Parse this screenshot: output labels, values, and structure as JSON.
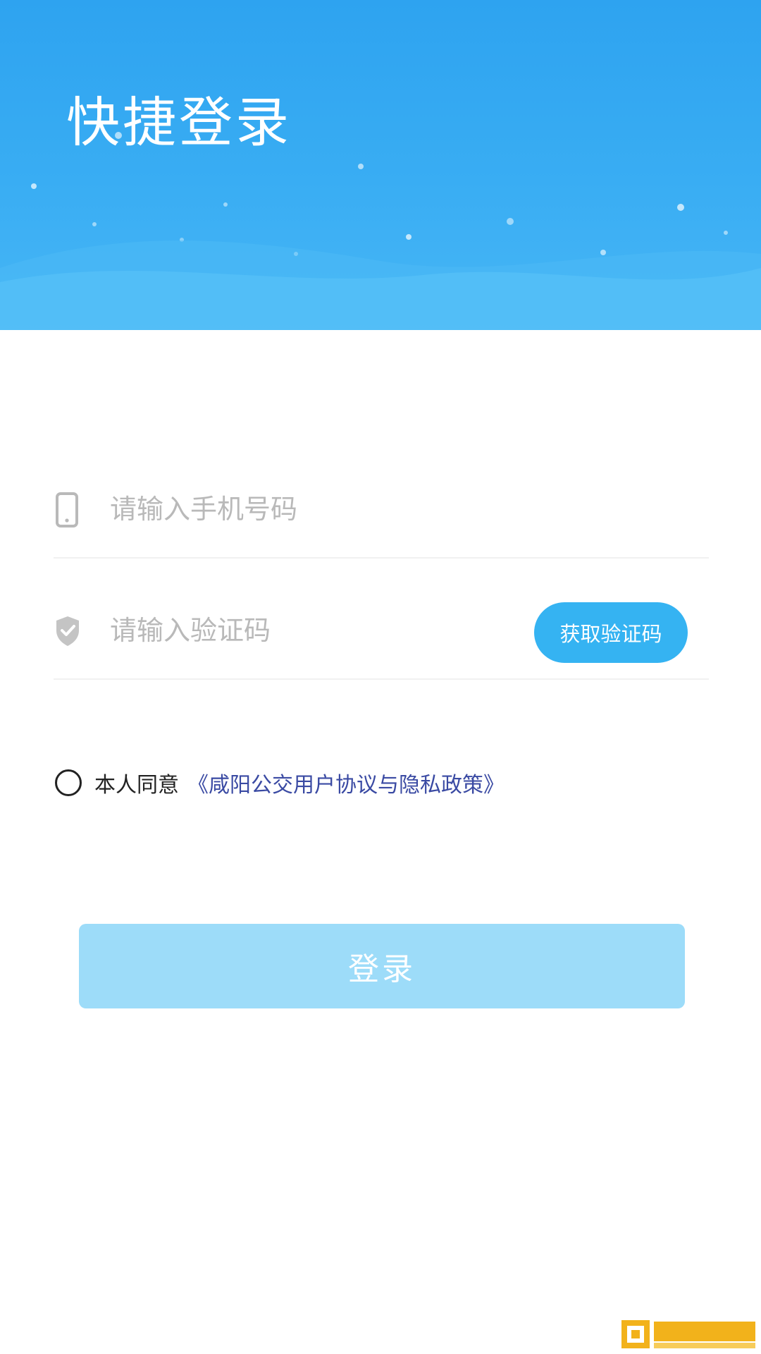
{
  "header": {
    "title": "快捷登录"
  },
  "form": {
    "phone": {
      "placeholder": "请输入手机号码",
      "icon": "phone-icon"
    },
    "code": {
      "placeholder": "请输入验证码",
      "icon": "shield-icon",
      "button_label": "获取验证码"
    }
  },
  "agreement": {
    "prefix": "本人同意",
    "link": "《咸阳公交用户协议与隐私政策》",
    "checked": false
  },
  "login": {
    "label": "登录"
  },
  "colors": {
    "banner": "#2ea3f0",
    "accent": "#35b3f2",
    "login_disabled": "#9ddcf9",
    "link": "#3a4aa3"
  }
}
